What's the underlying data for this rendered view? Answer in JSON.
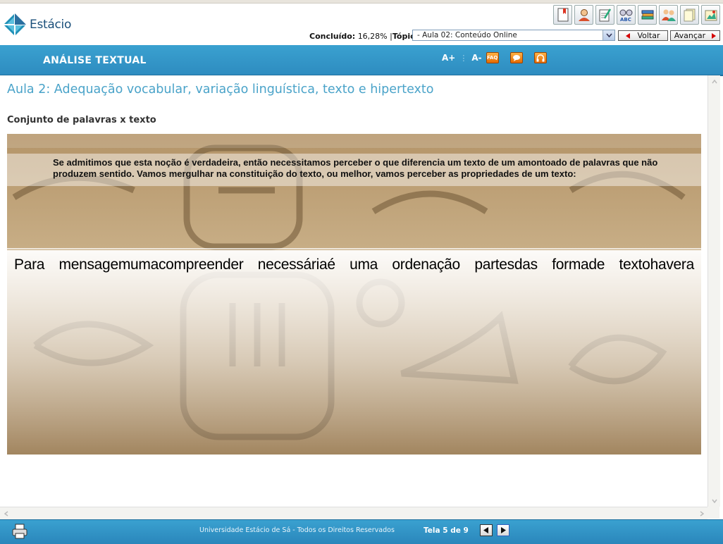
{
  "brand": {
    "name": "Estácio"
  },
  "toolbar": {
    "icons": [
      "bookmark-icon",
      "tutor-icon",
      "notes-icon",
      "glossary-icon",
      "library-icon",
      "forum-icon",
      "documents-icon",
      "map-icon"
    ]
  },
  "status": {
    "completed_label": "Concluído:",
    "completed_value": "16,28%",
    "separator": "|",
    "topic_label": "Tópico",
    "topic_value": "- Aula 02: Conteúdo Online"
  },
  "nav": {
    "back_label": "Voltar",
    "forward_label": "Avançar"
  },
  "header": {
    "course_title": "ANÁLISE TEXTUAL",
    "font_increase": "A+",
    "font_decrease": "A-",
    "faq_label": "FAQ"
  },
  "main": {
    "page_title": "Aula 2: Adequação vocabular, variação linguística, texto e hipertexto",
    "section_title": "Conjunto de palavras x texto",
    "intro_text": "Se admitimos que esta noção é verdadeira, então necessitamos perceber o que diferencia um texto de um amontoado de palavras que não produzem sentido. Vamos mergulhar na constituição do texto, ou melhor, vamos perceber as propriedades de um texto:",
    "scrambled_words": [
      "Para",
      "mensagem",
      "uma",
      "compreender",
      "necessária",
      "é",
      "uma",
      "ordenação",
      "partes",
      "das",
      "forma",
      "de",
      "texto",
      "haver",
      "a"
    ]
  },
  "footer": {
    "copyright": "Universidade Estácio de Sá - Todos os Direitos Reservados",
    "screen_label": "Tela 5 de 9"
  },
  "colors": {
    "accent": "#3aa1d0",
    "title": "#4aa3c9",
    "nav_arrow": "#d40000"
  }
}
